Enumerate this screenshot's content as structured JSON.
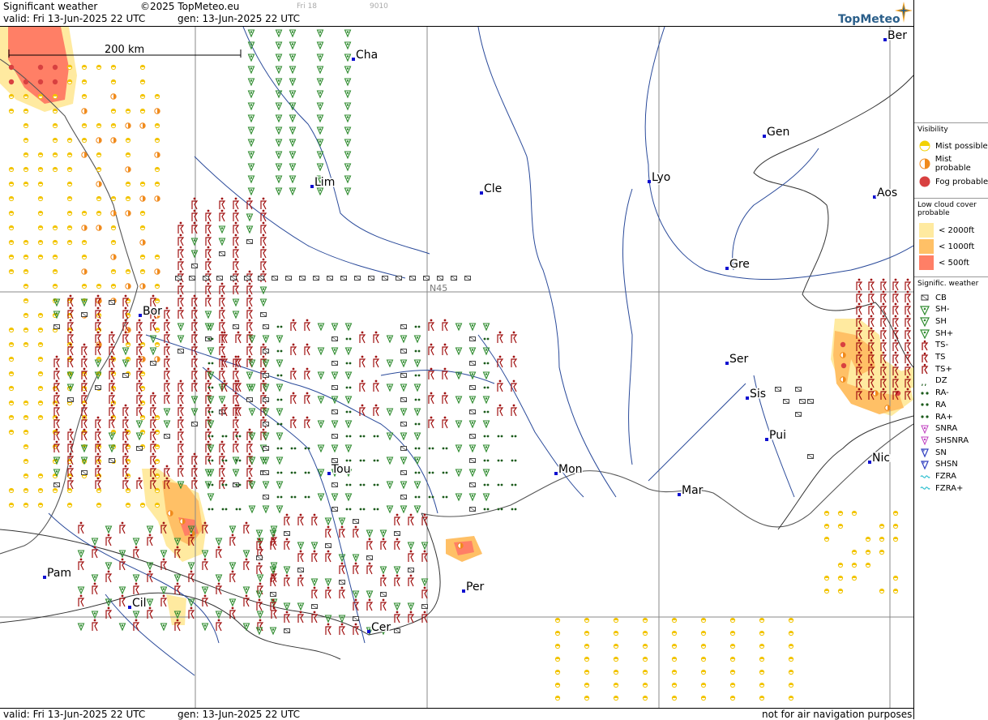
{
  "header": {
    "title": "Significant weather",
    "copyright": "©2025 TopMeteo.eu",
    "valid": "valid:  Fri  13-Jun-2025  22 UTC",
    "gen": "gen: 13-Jun-2025  22 UTC",
    "faint_day": "Fri 18",
    "faint_code": "9010",
    "brand": "TopMeteo"
  },
  "footer": {
    "valid": "valid:  Fri  13-Jun-2025  22 UTC",
    "gen": "gen: 13-Jun-2025  22 UTC",
    "disclaimer": "not for air navigation purposes"
  },
  "map": {
    "scale_label": "200 km",
    "grid_label": "N45",
    "cities": [
      {
        "name": "Cha"
      },
      {
        "name": "Lim"
      },
      {
        "name": "Bor"
      },
      {
        "name": "Cle"
      },
      {
        "name": "Lyo"
      },
      {
        "name": "Gen"
      },
      {
        "name": "Ber"
      },
      {
        "name": "Aos"
      },
      {
        "name": "Gre"
      },
      {
        "name": "Ser"
      },
      {
        "name": "Sis"
      },
      {
        "name": "Pui"
      },
      {
        "name": "Nic"
      },
      {
        "name": "Mar"
      },
      {
        "name": "Mon"
      },
      {
        "name": "Tou"
      },
      {
        "name": "Per"
      },
      {
        "name": "Cer"
      },
      {
        "name": "Pam"
      },
      {
        "name": "Cil"
      }
    ]
  },
  "legend": {
    "visibility_title": "Visibility",
    "visibility": [
      {
        "label": "Mist possible",
        "color": "#f2d100"
      },
      {
        "label": "Mist probable",
        "color": "#f08a1c"
      },
      {
        "label": "Fog probable",
        "color": "#d84040"
      }
    ],
    "cloud_title": "Low cloud cover probable",
    "cloud": [
      {
        "label": "< 2000ft",
        "color": "#ffeaa0"
      },
      {
        "label": "< 1000ft",
        "color": "#ffc066"
      },
      {
        "label": "<   500ft",
        "color": "#ff7f66"
      }
    ],
    "weather_title": "Signific. weather",
    "weather": [
      {
        "label": "CB",
        "icon": "cb-icon",
        "color": "#333333"
      },
      {
        "label": "SH-",
        "icon": "shower-light-icon",
        "color": "#2e8b2e"
      },
      {
        "label": "SH",
        "icon": "shower-icon",
        "color": "#2e8b2e"
      },
      {
        "label": "SH+",
        "icon": "shower-heavy-icon",
        "color": "#2e8b2e"
      },
      {
        "label": "TS-",
        "icon": "thunderstorm-light-icon",
        "color": "#a01010"
      },
      {
        "label": "TS",
        "icon": "thunderstorm-icon",
        "color": "#a01010"
      },
      {
        "label": "TS+",
        "icon": "thunderstorm-heavy-icon",
        "color": "#a01010"
      },
      {
        "label": "DZ",
        "icon": "drizzle-icon",
        "color": "#1a5a1a"
      },
      {
        "label": "RA-",
        "icon": "rain-light-icon",
        "color": "#1a5a1a"
      },
      {
        "label": "RA",
        "icon": "rain-icon",
        "color": "#1a5a1a"
      },
      {
        "label": "RA+",
        "icon": "rain-heavy-icon",
        "color": "#1a5a1a"
      },
      {
        "label": "SNRA",
        "icon": "snow-rain-icon",
        "color": "#c040c0"
      },
      {
        "label": "SHSNRA",
        "icon": "snow-rain-shower-icon",
        "color": "#c040c0"
      },
      {
        "label": "SN",
        "icon": "snow-icon",
        "color": "#3040c0"
      },
      {
        "label": "SHSN",
        "icon": "snow-shower-icon",
        "color": "#3040c0"
      },
      {
        "label": "FZRA",
        "icon": "freezing-rain-icon",
        "color": "#30c0d0"
      },
      {
        "label": "FZRA+",
        "icon": "freezing-rain-heavy-icon",
        "color": "#30c0d0"
      }
    ]
  }
}
